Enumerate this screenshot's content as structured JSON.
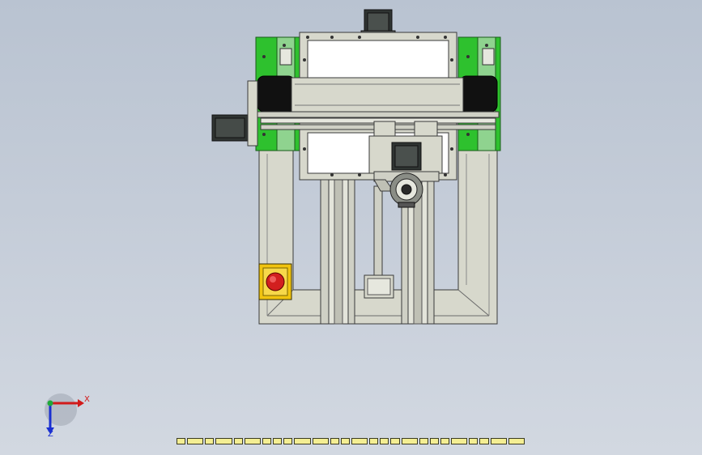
{
  "viewport": {
    "background_top": "#b9c3d1",
    "background_bottom": "#d2d8e1"
  },
  "model": {
    "colors": {
      "frame_fill": "#d7d8cc",
      "frame_stroke": "#3a3a3a",
      "plate_green": "#2ec12e",
      "panel_white": "#ffffff",
      "motor_dark": "#2f3432",
      "belt_black": "#111111",
      "estop_yellow": "#f1c40f",
      "estop_red": "#d21f1f"
    },
    "icons": [
      "stepper-motor-icon",
      "emergency-stop-icon"
    ]
  },
  "triad": {
    "x_label": "X",
    "y_label": "Z",
    "x_color": "#d11a1a",
    "y_color": "#1a2fd1",
    "origin_color": "#1faa3a"
  },
  "toolbar": {
    "segment_count": 26,
    "segment_color": "#f4ee93"
  }
}
